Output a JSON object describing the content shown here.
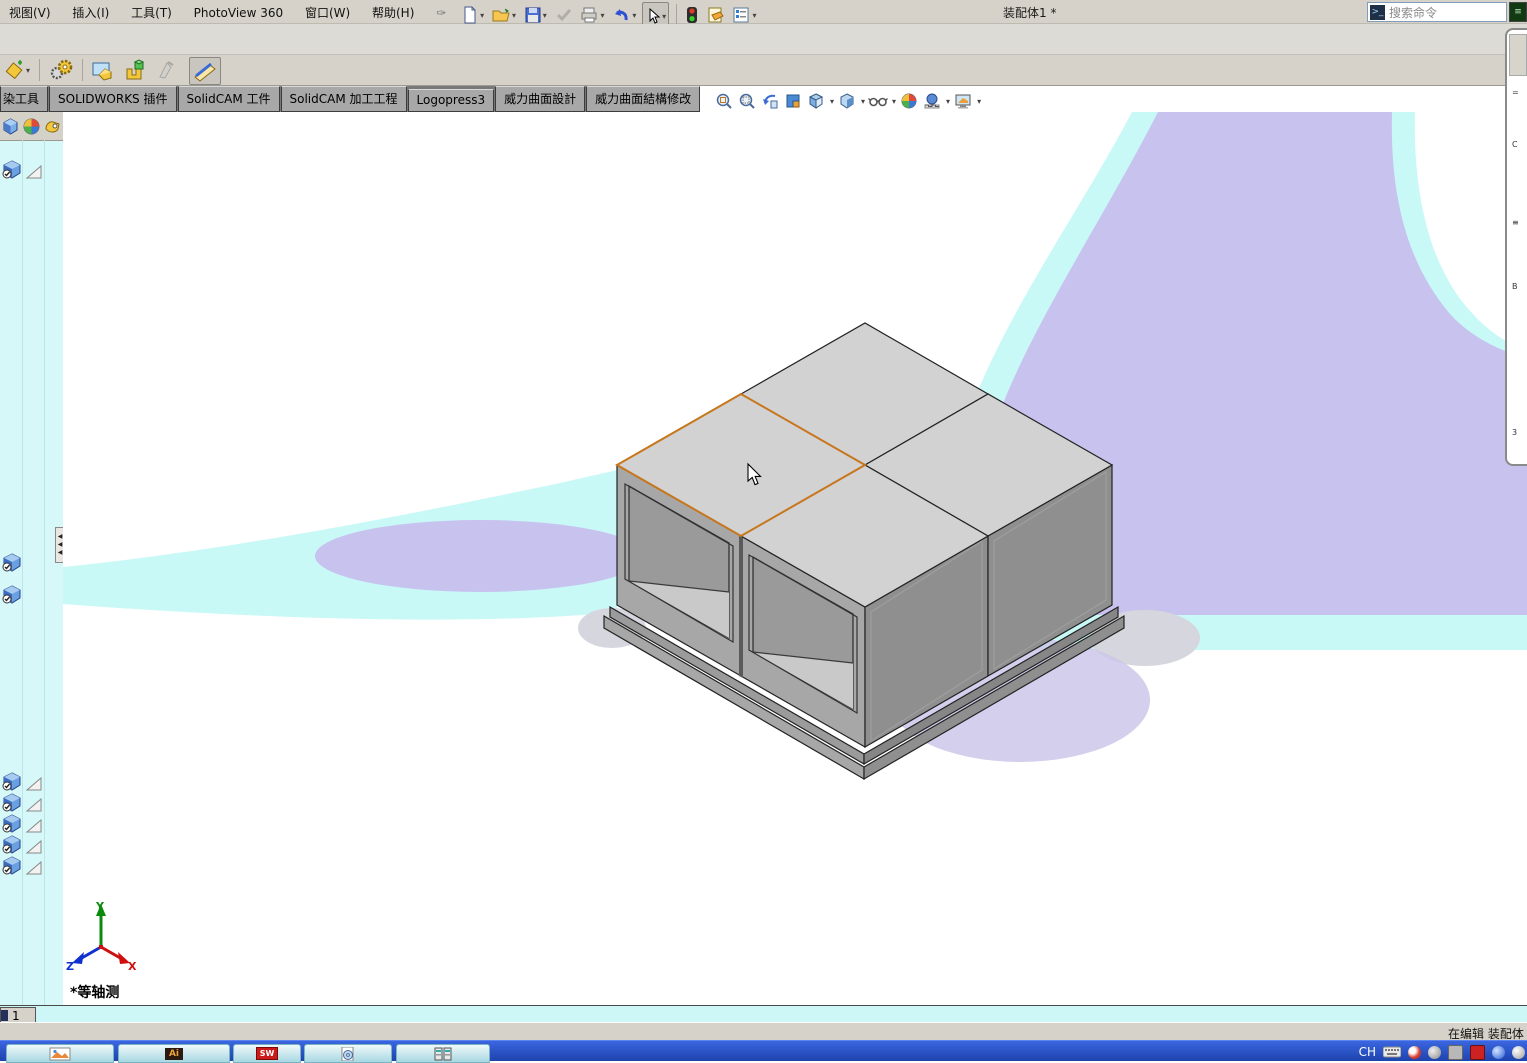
{
  "window": {
    "title": "装配体1 *",
    "search_placeholder": "搜索命令",
    "search_icon_glyph": ">_",
    "status_text": "在编辑 装配体",
    "view_label": "*等轴测",
    "sheet_tab": "1"
  },
  "menu": {
    "items": [
      "视图(V)",
      "插入(I)",
      "工具(T)",
      "PhotoView 360",
      "窗口(W)",
      "帮助(H)"
    ]
  },
  "command_tabs": {
    "tabs": [
      "染工具",
      "SOLIDWORKS 插件",
      "SolidCAM 工件",
      "SolidCAM 加工工程",
      "Logopress3",
      "威力曲面設計",
      "威力曲面結構修改"
    ]
  },
  "toolbars": {
    "standard": [
      "new-document",
      "open",
      "save",
      "reserved",
      "print",
      "undo",
      "select-cursor",
      "rebuild",
      "file-properties",
      "options"
    ],
    "assembly": [
      "insert-component",
      "mate",
      "component-preview",
      "move-component",
      "disabled-tool",
      "active-tool"
    ],
    "heads_up": [
      "zoom-to-fit",
      "zoom-to-area",
      "previous-view",
      "section-view",
      "view-orientation",
      "display-style",
      "hide-show-items",
      "edit-appearance",
      "apply-scene",
      "view-settings"
    ]
  },
  "triad": {
    "x": "X",
    "y": "Y",
    "z": "Z"
  },
  "taskbar": {
    "language": "CH",
    "app_ai": "Ai",
    "app_sw": "SW"
  },
  "icons": {
    "dropdown": "▾",
    "splitter": "◀",
    "pin": "✑"
  },
  "colors": {
    "accent_orange": "#c8761c",
    "viewport_cyan": "#c9f9f7",
    "viewport_lavender": "#c7c2ee",
    "model_top": "#d2d2d2",
    "model_left": "#a7a7a7",
    "model_right": "#8f8f8f",
    "model_inner": "#9a9a9a",
    "model_floor": "#c9c9c9",
    "shadow_gray": "#d6d6de",
    "shadow_lavender": "#cbc7e9",
    "edge": "#222222"
  }
}
